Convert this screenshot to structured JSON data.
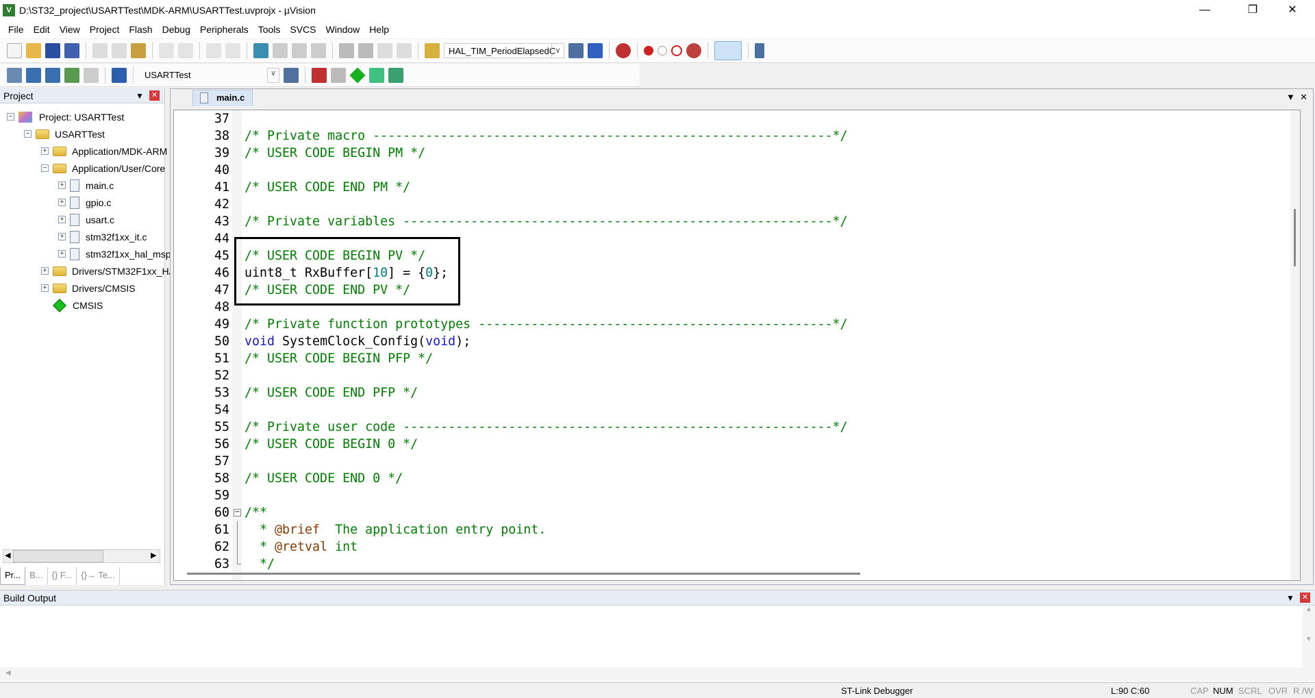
{
  "window": {
    "title": "D:\\ST32_project\\USARTTest\\MDK-ARM\\USARTTest.uvprojx - µVision",
    "app_icon": "uvision-logo",
    "accent": "#2e7d32"
  },
  "menu": [
    "File",
    "Edit",
    "View",
    "Project",
    "Flash",
    "Debug",
    "Peripherals",
    "Tools",
    "SVCS",
    "Window",
    "Help"
  ],
  "toolbar1": {
    "find_combo": "HAL_TIM_PeriodElapsedC"
  },
  "toolbar2": {
    "target_combo": "USARTTest"
  },
  "project_panel": {
    "title": "Project",
    "tree": [
      {
        "label": "Project: USARTTest",
        "level": 0,
        "expanded": true,
        "icon": "project-icon"
      },
      {
        "label": "USARTTest",
        "level": 1,
        "expanded": true,
        "icon": "target-folder-icon"
      },
      {
        "label": "Application/MDK-ARM",
        "level": 2,
        "expanded": false,
        "icon": "folder-icon"
      },
      {
        "label": "Application/User/Core",
        "level": 2,
        "expanded": true,
        "icon": "folder-open-icon"
      },
      {
        "label": "main.c",
        "level": 3,
        "expanded": false,
        "icon": "file-icon"
      },
      {
        "label": "gpio.c",
        "level": 3,
        "expanded": false,
        "icon": "file-icon"
      },
      {
        "label": "usart.c",
        "level": 3,
        "expanded": false,
        "icon": "file-icon"
      },
      {
        "label": "stm32f1xx_it.c",
        "level": 3,
        "expanded": false,
        "icon": "file-icon"
      },
      {
        "label": "stm32f1xx_hal_msp.c",
        "level": 3,
        "expanded": false,
        "icon": "file-icon"
      },
      {
        "label": "Drivers/STM32F1xx_HAL_Driver",
        "level": 2,
        "expanded": false,
        "icon": "folder-icon"
      },
      {
        "label": "Drivers/CMSIS",
        "level": 2,
        "expanded": false,
        "icon": "folder-icon"
      },
      {
        "label": "CMSIS",
        "level": 2,
        "icon": "cmsis-icon"
      }
    ],
    "tabs": [
      "Pr...",
      "B...",
      "{} F...",
      "{}→ Te..."
    ]
  },
  "editor": {
    "tab": "main.c",
    "lines": [
      {
        "n": "37",
        "parts": []
      },
      {
        "n": "38",
        "parts": [
          [
            "cm",
            "/* Private macro -------------------------------------------------------------*/"
          ]
        ]
      },
      {
        "n": "39",
        "parts": [
          [
            "cm",
            "/* USER CODE BEGIN PM */"
          ]
        ]
      },
      {
        "n": "40",
        "parts": []
      },
      {
        "n": "41",
        "parts": [
          [
            "cm",
            "/* USER CODE END PM */"
          ]
        ]
      },
      {
        "n": "42",
        "parts": []
      },
      {
        "n": "43",
        "parts": [
          [
            "cm",
            "/* Private variables ---------------------------------------------------------*/"
          ]
        ]
      },
      {
        "n": "44",
        "parts": []
      },
      {
        "n": "45",
        "parts": [
          [
            "cm",
            "/* USER CODE BEGIN PV */"
          ]
        ]
      },
      {
        "n": "46",
        "parts": [
          [
            "",
            "uint8_t RxBuffer["
          ],
          [
            "num",
            "10"
          ],
          [
            "",
            "] = {"
          ],
          [
            "num",
            "0"
          ],
          [
            "",
            "};"
          ]
        ]
      },
      {
        "n": "47",
        "parts": [
          [
            "cm",
            "/* USER CODE END PV */"
          ]
        ]
      },
      {
        "n": "48",
        "parts": []
      },
      {
        "n": "49",
        "parts": [
          [
            "cm",
            "/* Private function prototypes -----------------------------------------------*/"
          ]
        ]
      },
      {
        "n": "50",
        "parts": [
          [
            "kw",
            "void"
          ],
          [
            "",
            " SystemClock_Config("
          ],
          [
            "kw",
            "void"
          ],
          [
            "",
            ");"
          ]
        ]
      },
      {
        "n": "51",
        "parts": [
          [
            "cm",
            "/* USER CODE BEGIN PFP */"
          ]
        ]
      },
      {
        "n": "52",
        "parts": []
      },
      {
        "n": "53",
        "parts": [
          [
            "cm",
            "/* USER CODE END PFP */"
          ]
        ]
      },
      {
        "n": "54",
        "parts": []
      },
      {
        "n": "55",
        "parts": [
          [
            "cm",
            "/* Private user code ---------------------------------------------------------*/"
          ]
        ]
      },
      {
        "n": "56",
        "parts": [
          [
            "cm",
            "/* USER CODE BEGIN 0 */"
          ]
        ]
      },
      {
        "n": "57",
        "parts": []
      },
      {
        "n": "58",
        "parts": [
          [
            "cm",
            "/* USER CODE END 0 */"
          ]
        ]
      },
      {
        "n": "59",
        "parts": []
      },
      {
        "n": "60",
        "parts": [
          [
            "cm",
            "/**"
          ]
        ],
        "fold": "start"
      },
      {
        "n": "61",
        "parts": [
          [
            "cm",
            "  * "
          ],
          [
            "tag",
            "@brief"
          ],
          [
            "cm",
            "  The application entry point."
          ]
        ],
        "fold": "mid"
      },
      {
        "n": "62",
        "parts": [
          [
            "cm",
            "  * "
          ],
          [
            "tag",
            "@retval"
          ],
          [
            "cm",
            " int"
          ]
        ],
        "fold": "mid"
      },
      {
        "n": "63",
        "parts": [
          [
            "cm",
            "  */"
          ]
        ],
        "fold": "end"
      }
    ],
    "colors": {
      "comment": "#008000",
      "keyword": "#1818c8",
      "number": "#008080",
      "doc_tag": "#8a3a00"
    }
  },
  "build_output": {
    "title": "Build Output"
  },
  "status": {
    "debugger": "ST-Link Debugger",
    "position": "L:90 C:60",
    "cap": "CAP",
    "num": "NUM",
    "scrl": "SCRL",
    "ovr": "OVR",
    "rw": "R /W"
  }
}
